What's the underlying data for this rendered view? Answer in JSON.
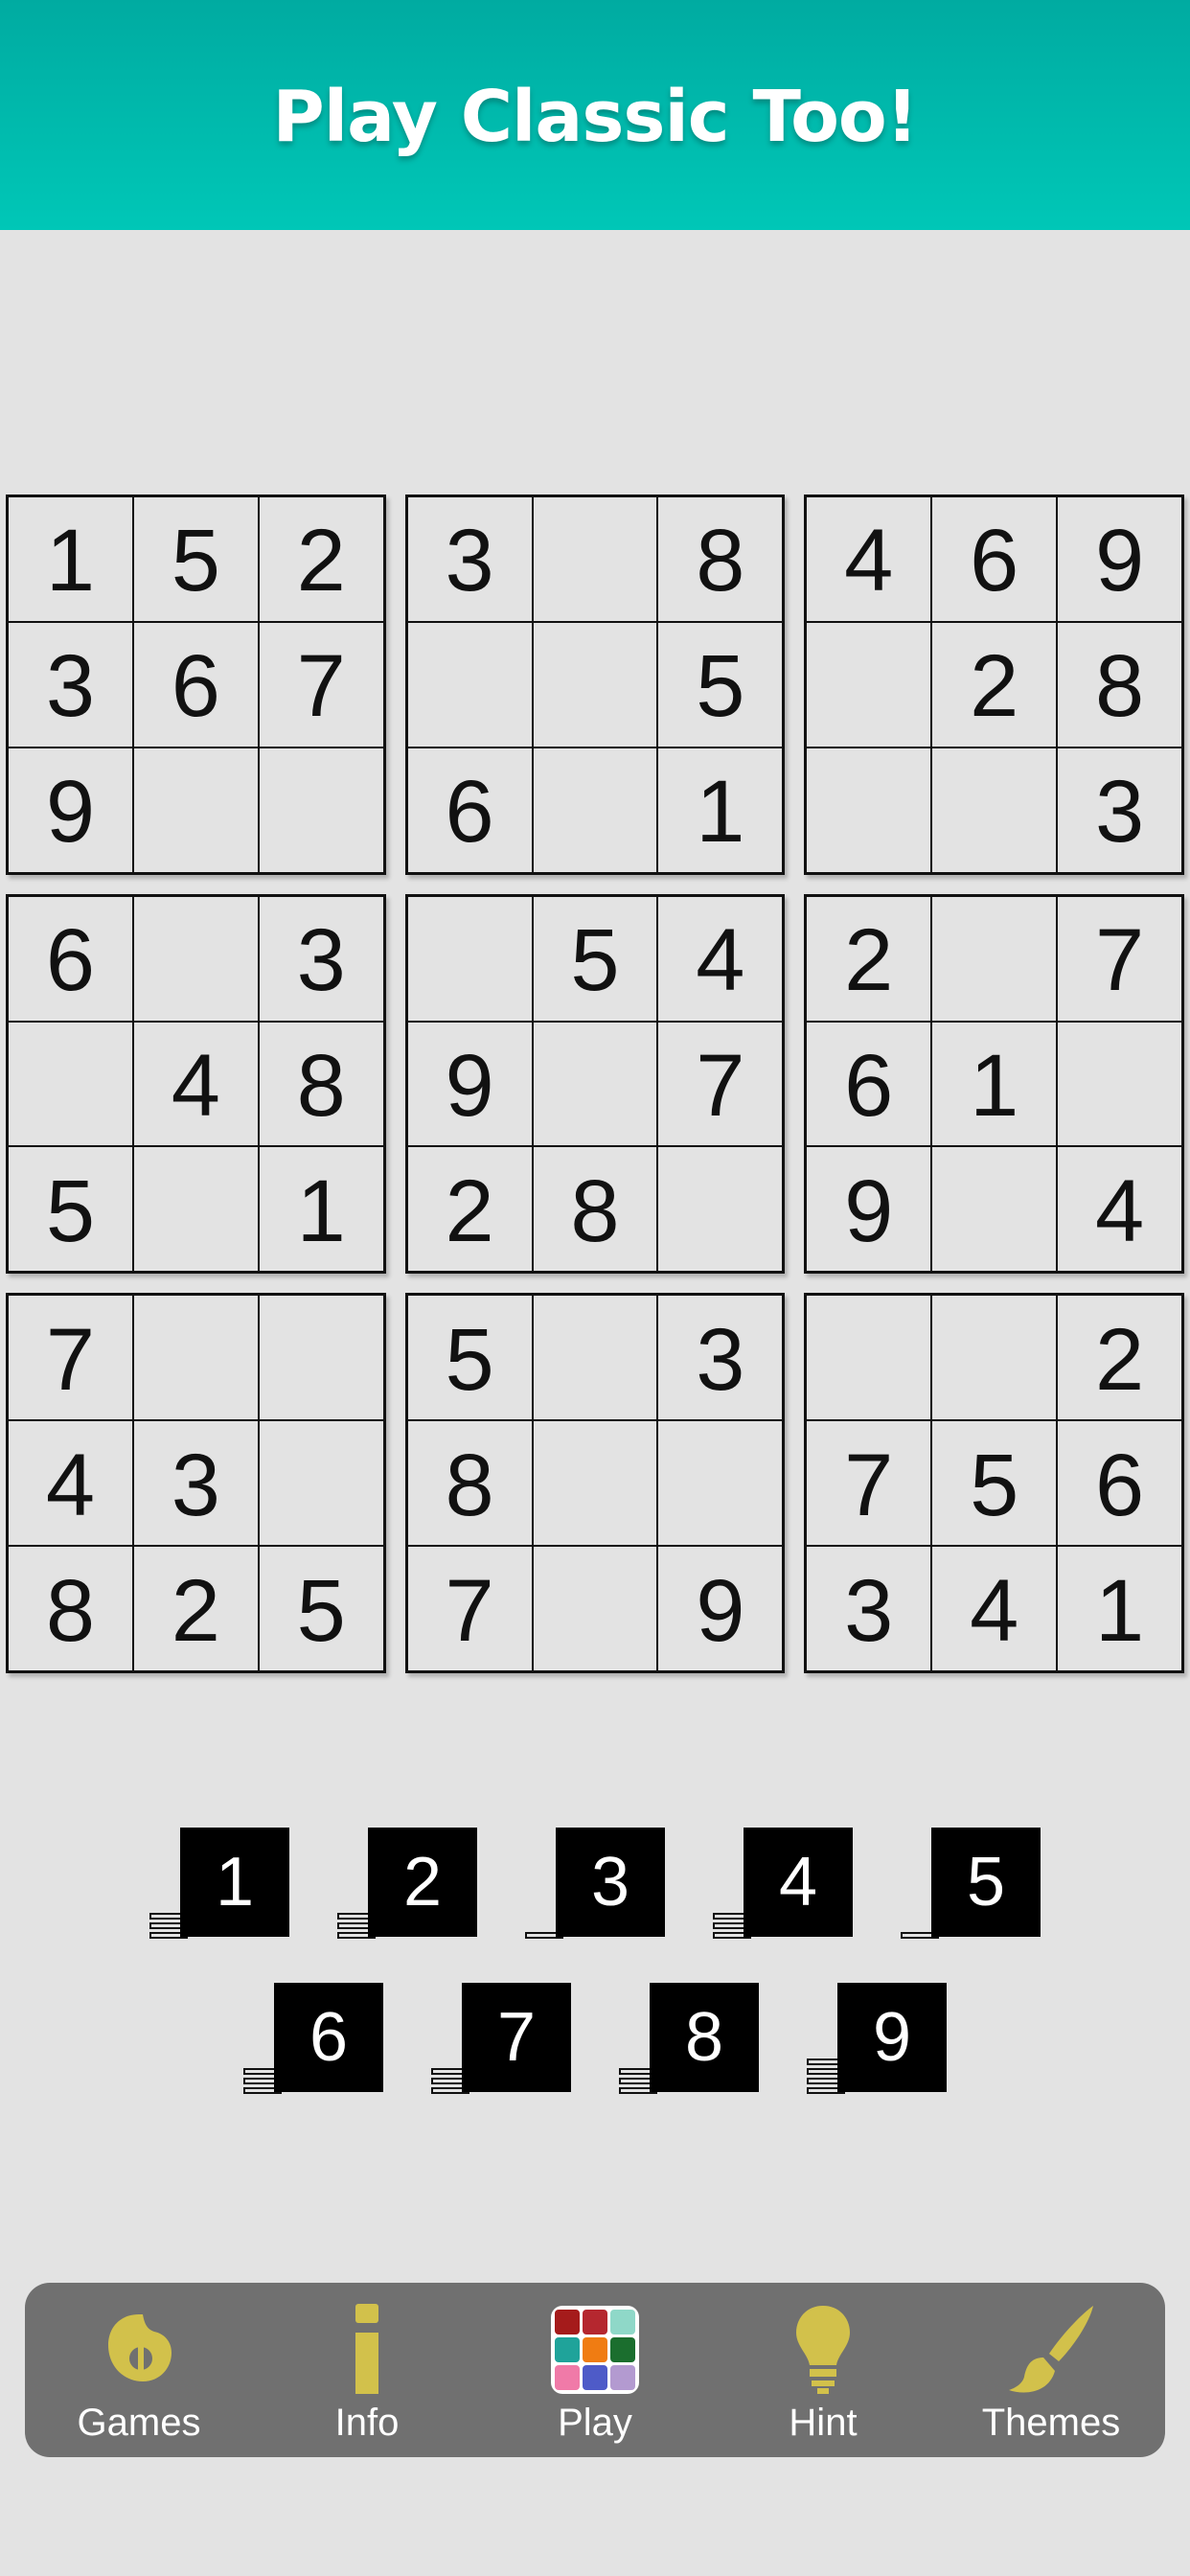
{
  "header": {
    "title": "Play Classic Too!",
    "gradient_top": "#00aba1",
    "gradient_bottom": "#00c7b7"
  },
  "board": {
    "grid": [
      [
        "1",
        "5",
        "2",
        "3",
        "",
        "8",
        "4",
        "6",
        "9"
      ],
      [
        "3",
        "6",
        "7",
        "",
        "",
        "5",
        "",
        "2",
        "8"
      ],
      [
        "9",
        "",
        "",
        "6",
        "",
        "1",
        "",
        "",
        "3"
      ],
      [
        "6",
        "",
        "3",
        "",
        "5",
        "4",
        "2",
        "",
        "7"
      ],
      [
        "",
        "4",
        "8",
        "9",
        "",
        "7",
        "6",
        "1",
        ""
      ],
      [
        "5",
        "",
        "1",
        "2",
        "8",
        "",
        "9",
        "",
        "4"
      ],
      [
        "7",
        "",
        "",
        "5",
        "",
        "3",
        "",
        "",
        "2"
      ],
      [
        "4",
        "3",
        "",
        "8",
        "",
        "",
        "7",
        "5",
        "6"
      ],
      [
        "8",
        "2",
        "5",
        "7",
        "",
        "9",
        "3",
        "4",
        "1"
      ]
    ]
  },
  "number_pad": {
    "rows": [
      [
        {
          "digit": "1",
          "placed": 3
        },
        {
          "digit": "2",
          "placed": 3
        },
        {
          "digit": "3",
          "placed": 1
        },
        {
          "digit": "4",
          "placed": 3
        },
        {
          "digit": "5",
          "placed": 1
        }
      ],
      [
        {
          "digit": "6",
          "placed": 3
        },
        {
          "digit": "7",
          "placed": 3
        },
        {
          "digit": "8",
          "placed": 3
        },
        {
          "digit": "9",
          "placed": 4
        }
      ]
    ]
  },
  "bottom_nav": {
    "background": "#707070",
    "items": [
      {
        "label": "Games",
        "icon": "games-icon"
      },
      {
        "label": "Info",
        "icon": "info-icon"
      },
      {
        "label": "Play",
        "icon": "play-grid-icon"
      },
      {
        "label": "Hint",
        "icon": "lightbulb-icon"
      },
      {
        "label": "Themes",
        "icon": "paintbrush-icon"
      }
    ],
    "icon_color": "#d2c14b",
    "play_icon_colors": [
      "#a51b1b",
      "#b5272f",
      "#8fd8c8",
      "#1fa39a",
      "#f07c12",
      "#1b6e2e",
      "#f07aa8",
      "#4e5bc8",
      "#b39ad0"
    ]
  }
}
